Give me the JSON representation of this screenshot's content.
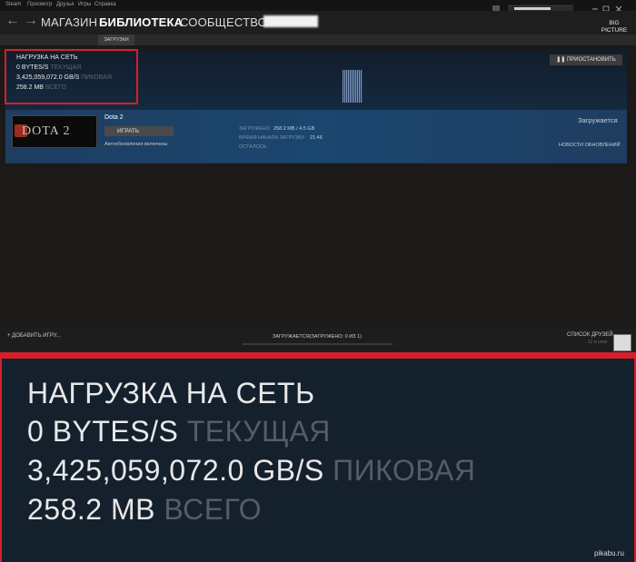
{
  "menu": [
    "Steam",
    "Просмотр",
    "Друзья",
    "Игры",
    "Справка"
  ],
  "nav": {
    "store": "МАГАЗИН",
    "library": "БИБЛИОТЕКА",
    "community": "СООБЩЕСТВО"
  },
  "subnav": {
    "downloads_tab": "ЗАГРУЗКИ"
  },
  "big_picture": {
    "line1": "BIG",
    "line2": "PICTURE"
  },
  "network": {
    "title": "НАГРУЗКА НА СЕТЬ",
    "current_value": "0 BYTES/S",
    "current_label": "ТЕКУЩАЯ",
    "peak_value": "3,425,059,072.0 GB/S",
    "peak_label": "ПИКОВАЯ",
    "total_value": "258.2 MB",
    "total_label": "ВСЕГО"
  },
  "pause_label": "ПРИОСТАНОВИТЬ",
  "game": {
    "logo_text": "DOTA 2",
    "title": "Dota 2",
    "play_label": "ИГРАТЬ",
    "auto_updates": "Автообновления включены",
    "stat_downloaded_label": "ЗАГРУЖЕНО",
    "stat_downloaded_value": "258.2 MB / 4.5 GB",
    "stat_start_label": "ВРЕМЯ НАЧАЛА ЗАГРУЗКИ",
    "stat_start_value": "21:46",
    "stat_remaining_label": "ОСТАЛОСЬ",
    "status": "Загружается",
    "news_link": "НОВОСТИ ОБНОВЛЕНИЙ"
  },
  "bottom": {
    "add_game": "ДОБАВИТЬ ИГРУ...",
    "download_status": "ЗАГРУЖАЕТСЯ(ЗАГРУЖЕНО: 0 ИЗ 1)",
    "friends_list": "СПИСОК ДРУЗЕЙ",
    "friends_sub": "12 в сети"
  },
  "watermark": "pikabu.ru",
  "colors": {
    "highlight_red": "#d4202a",
    "panel_blue": "#1b3a5c",
    "background": "#1b1a19"
  }
}
